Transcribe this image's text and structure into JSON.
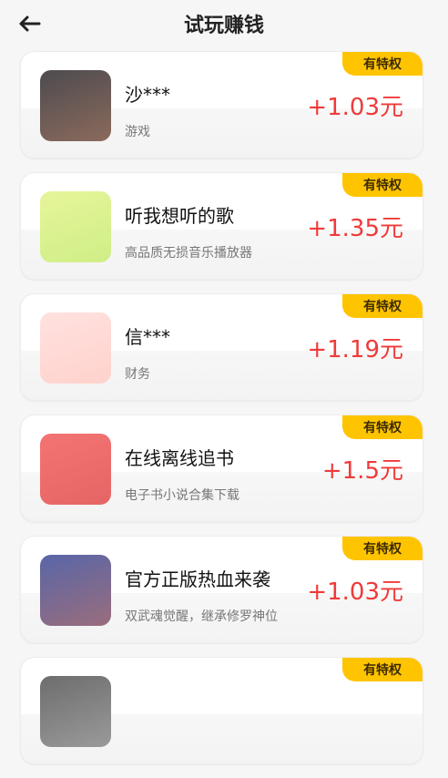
{
  "header": {
    "title": "试玩赚钱",
    "back_icon": "back-arrow-icon"
  },
  "colors": {
    "badge": "#ffc400",
    "reward": "#f03a3a"
  },
  "cards": [
    {
      "badge": "有特权",
      "name": "沙***",
      "desc": "游戏",
      "reward": "+1.03元",
      "icon_colors": [
        "#4d4b4f",
        "#8b6a5c"
      ]
    },
    {
      "badge": "有特权",
      "name": "听我想听的歌",
      "desc": "高品质无损音乐播放器",
      "reward": "+1.35元",
      "icon_colors": [
        "#e6f59a",
        "#cfee87"
      ]
    },
    {
      "badge": "有特权",
      "name": "信***",
      "desc": "财务",
      "reward": "+1.19元",
      "icon_colors": [
        "#ffe1df",
        "#ffd2cc"
      ]
    },
    {
      "badge": "有特权",
      "name": "在线离线追书",
      "desc": "电子书小说合集下载",
      "reward": "+1.5元",
      "icon_colors": [
        "#f47474",
        "#e56565"
      ]
    },
    {
      "badge": "有特权",
      "name": "官方正版热血来袭",
      "desc": "双武魂觉醒，继承修罗神位",
      "reward": "+1.03元",
      "icon_colors": [
        "#5866a8",
        "#9a6d7c"
      ]
    },
    {
      "badge": "有特权",
      "name": "",
      "desc": "",
      "reward": "",
      "icon_colors": [
        "#6d6d6d",
        "#9a9a9a"
      ]
    }
  ]
}
